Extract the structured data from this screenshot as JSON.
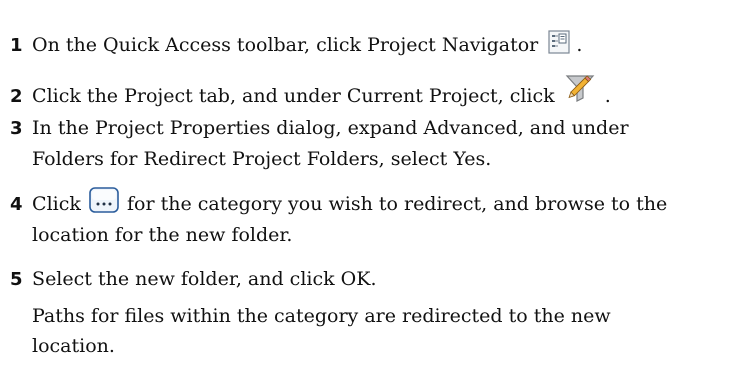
{
  "steps": [
    {
      "number": "1",
      "text_before_icon": "On the Quick Access toolbar, click Project Navigator",
      "icon": "project-navigator-icon",
      "text_after_icon": "."
    },
    {
      "number": "2",
      "text_before_icon": "Click the Project tab, and under Current Project, click",
      "icon": "edit-project-icon",
      "text_after_icon": "."
    },
    {
      "number": "3",
      "line1": "In the Project Properties dialog, expand Advanced, and under",
      "line2": "Folders for Redirect Project Folders, select Yes."
    },
    {
      "number": "4",
      "text_before_icon": "Click",
      "icon": "browse-ellipsis-icon",
      "text_after_icon": "for the category you wish to redirect, and browse to the",
      "line2": "location for the new folder."
    },
    {
      "number": "5",
      "text": "Select the new folder, and click OK."
    }
  ],
  "note": {
    "line1": "Paths for files within the category are redirected to the new",
    "line2": "location."
  }
}
